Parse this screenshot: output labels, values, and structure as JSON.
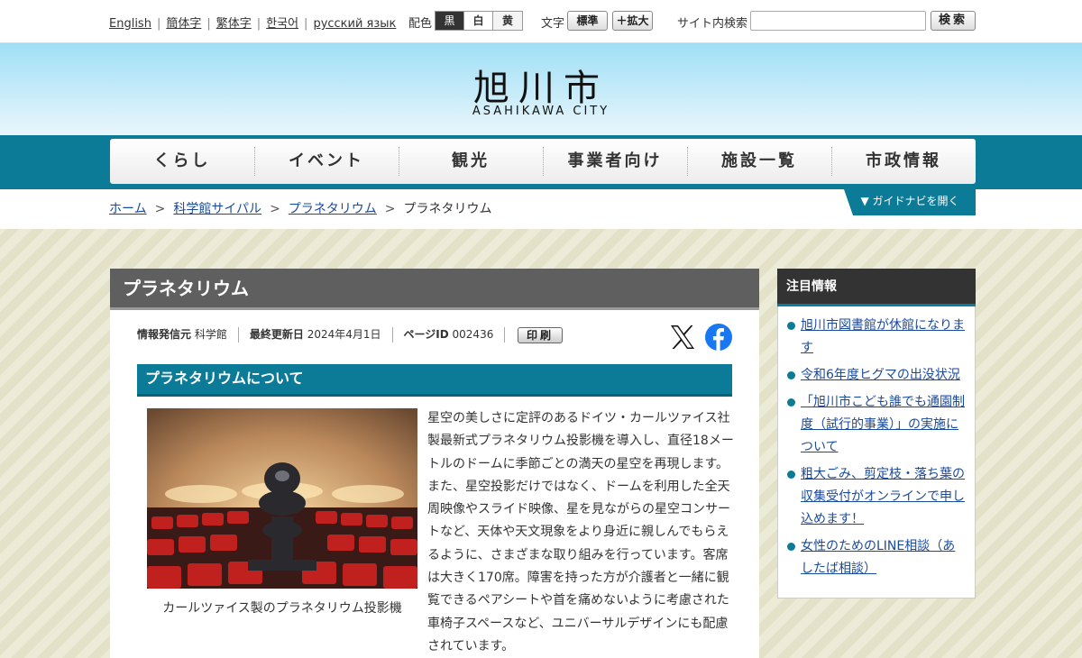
{
  "topbar": {
    "languages": [
      "English",
      "簡体字",
      "繁体字",
      "한국어",
      "русский язык"
    ],
    "color_label": "配色",
    "color_options": [
      "黒",
      "白",
      "黄"
    ],
    "font_label": "文字",
    "font_standard": "標準",
    "font_larger": "＋拡大",
    "search_label": "サイト内検索",
    "search_value": "",
    "search_button": "検索"
  },
  "header": {
    "logo_title": "旭川市",
    "logo_subtitle": "ASAHIKAWA CITY"
  },
  "nav": [
    "くらし",
    "イベント",
    "観光",
    "事業者向け",
    "施設一覧",
    "市政情報"
  ],
  "breadcrumb": {
    "links": [
      "ホーム",
      "科学館サイパル",
      "プラネタリウム"
    ],
    "separator": ">",
    "current": "プラネタリウム"
  },
  "guide_button": "▼ ガイドナビを開く",
  "main": {
    "page_title": "プラネタリウム",
    "meta": {
      "source_label": "情報発信元",
      "source_value": "科学館",
      "updated_label": "最終更新日",
      "updated_value": "2024年4月1日",
      "page_id_label": "ページID",
      "page_id_value": "002436",
      "print_button": "印刷"
    },
    "share_icons": [
      "x-logo-icon",
      "facebook-icon"
    ],
    "section_heading": "プラネタリウムについて",
    "image_caption": "カールツァイス製のプラネタリウム投影機",
    "body_text": "星空の美しさに定評のあるドイツ・カールツァイス社製最新式プラネタリウム投影機を導入し、直径18メートルのドームに季節ごとの満天の星空を再現します。また、星空投影だけではなく、ドームを利用した全天周映像やスライド映像、星を見ながらの星空コンサートなど、天体や天文現象をより身近に親しんでもらえるように、さまざまな取り組みを行っています。客席は大きく170席。障害を持った方が介護者と一緒に観覧できるペアシートや首を痛めないように考慮された車椅子スペースなど、ユニバーサルデザインにも配慮されています。"
  },
  "sidebar": {
    "heading": "注目情報",
    "items": [
      "旭川市図書館が休館になります",
      "令和6年度ヒグマの出没状況",
      "「旭川市こども誰でも通園制度（試行的事業）」の実施について",
      "粗大ごみ、剪定枝・落ち葉の収集受付がオンラインで申し込めます！",
      "女性のためのLINE相談（あしたば相談）"
    ]
  },
  "colors": {
    "accent_teal": "#0b7b98",
    "title_bar_gray": "#5f5f5f",
    "link_blue": "#1a4a9c"
  }
}
